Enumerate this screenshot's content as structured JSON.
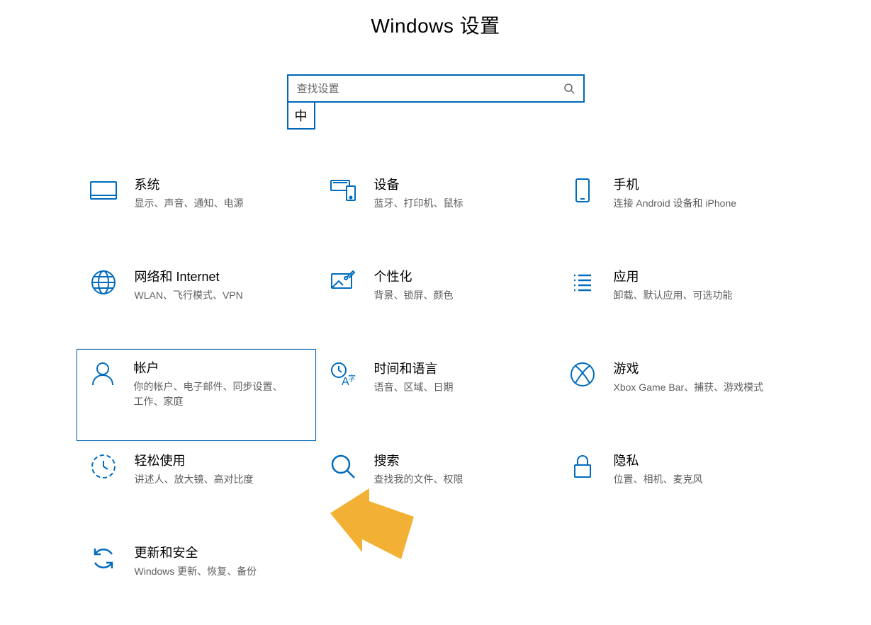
{
  "page": {
    "title": "Windows 设置"
  },
  "search": {
    "placeholder": "查找设置"
  },
  "ime": {
    "label": "中"
  },
  "tiles": [
    {
      "id": "system",
      "title": "系统",
      "desc": "显示、声音、通知、电源"
    },
    {
      "id": "devices",
      "title": "设备",
      "desc": "蓝牙、打印机、鼠标"
    },
    {
      "id": "phone",
      "title": "手机",
      "desc": "连接 Android 设备和 iPhone"
    },
    {
      "id": "network",
      "title": "网络和 Internet",
      "desc": "WLAN、飞行模式、VPN"
    },
    {
      "id": "personal",
      "title": "个性化",
      "desc": "背景、锁屏、颜色"
    },
    {
      "id": "apps",
      "title": "应用",
      "desc": "卸载、默认应用、可选功能"
    },
    {
      "id": "accounts",
      "title": "帐户",
      "desc": "你的帐户、电子邮件、同步设置、工作、家庭",
      "highlight": true
    },
    {
      "id": "time",
      "title": "时间和语言",
      "desc": "语音、区域、日期"
    },
    {
      "id": "gaming",
      "title": "游戏",
      "desc": "Xbox Game Bar、捕获、游戏模式"
    },
    {
      "id": "ease",
      "title": "轻松使用",
      "desc": "讲述人、放大镜、高对比度"
    },
    {
      "id": "searchc",
      "title": "搜索",
      "desc": "查找我的文件、权限"
    },
    {
      "id": "privacy",
      "title": "隐私",
      "desc": "位置、相机、麦克风"
    },
    {
      "id": "update",
      "title": "更新和安全",
      "desc": "Windows 更新、恢复、备份"
    }
  ],
  "annotation": {
    "arrow_target": "accounts",
    "arrow_color": "#f2b134"
  }
}
